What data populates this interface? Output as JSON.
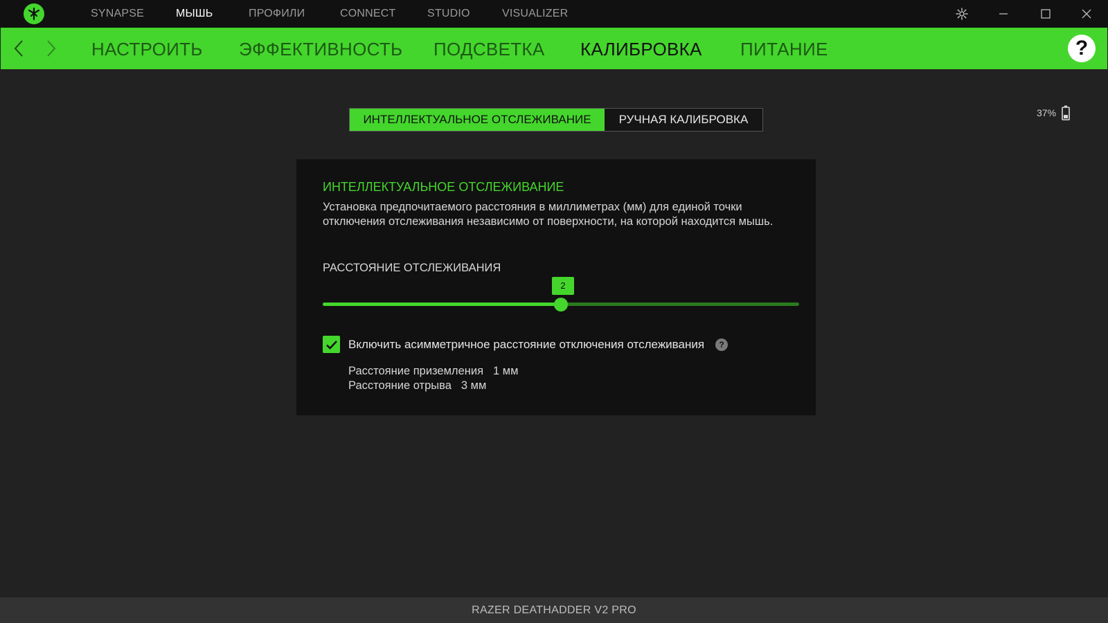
{
  "titlebar": {
    "nav": [
      {
        "label": "SYNAPSE",
        "active": false
      },
      {
        "label": "МЫШЬ",
        "active": true
      },
      {
        "label": "ПРОФИЛИ",
        "active": false
      },
      {
        "label": "CONNECT",
        "active": false
      },
      {
        "label": "STUDIO",
        "active": false
      },
      {
        "label": "VISUALIZER",
        "active": false
      }
    ],
    "icons": {
      "settings": "gear-icon",
      "minimize": "minimize-icon",
      "maximize": "maximize-icon",
      "close": "close-icon"
    }
  },
  "subnav": {
    "tabs": [
      {
        "label": "НАСТРОИТЬ",
        "active": false
      },
      {
        "label": "ЭФФЕКТИВНОСТЬ",
        "active": false
      },
      {
        "label": "ПОДСВЕТКА",
        "active": false
      },
      {
        "label": "КАЛИБРОВКА",
        "active": true
      },
      {
        "label": "ПИТАНИЕ",
        "active": false
      }
    ],
    "help_label": "?"
  },
  "battery": {
    "percent_text": "37%",
    "level": 0.37
  },
  "mode_toggle": {
    "active_label": "ИНТЕЛЛЕКТУАЛЬНОЕ ОТСЛЕЖИВАНИЕ",
    "inactive_label": "РУЧНАЯ КАЛИБРОВКА"
  },
  "card": {
    "title": "ИНТЕЛЛЕКТУАЛЬНОЕ ОТСЛЕЖИВАНИЕ",
    "description": "Установка предпочитаемого расстояния в миллиметрах (мм) для единой точки отключения отслеживания независимо от поверхности, на которой находится мышь.",
    "section_label": "РАССТОЯНИЕ ОТСЛЕЖИВАНИЯ",
    "slider": {
      "value": 2,
      "value_label": "2",
      "fraction": 0.5
    },
    "asymmetric": {
      "checked": true,
      "label": "Включить асимметричное расстояние отключения отслеживания",
      "info_label": "?"
    },
    "landing": {
      "label": "Расстояние приземления",
      "value": "1 мм"
    },
    "liftoff": {
      "label": "Расстояние отрыва",
      "value": "3 мм"
    }
  },
  "footer": {
    "device_name": "RAZER DEATHADDER V2 PRO"
  },
  "colors": {
    "accent": "#44d62c",
    "background": "#222222",
    "card": "#111111",
    "titlebar": "#111111",
    "footer": "#333333"
  }
}
